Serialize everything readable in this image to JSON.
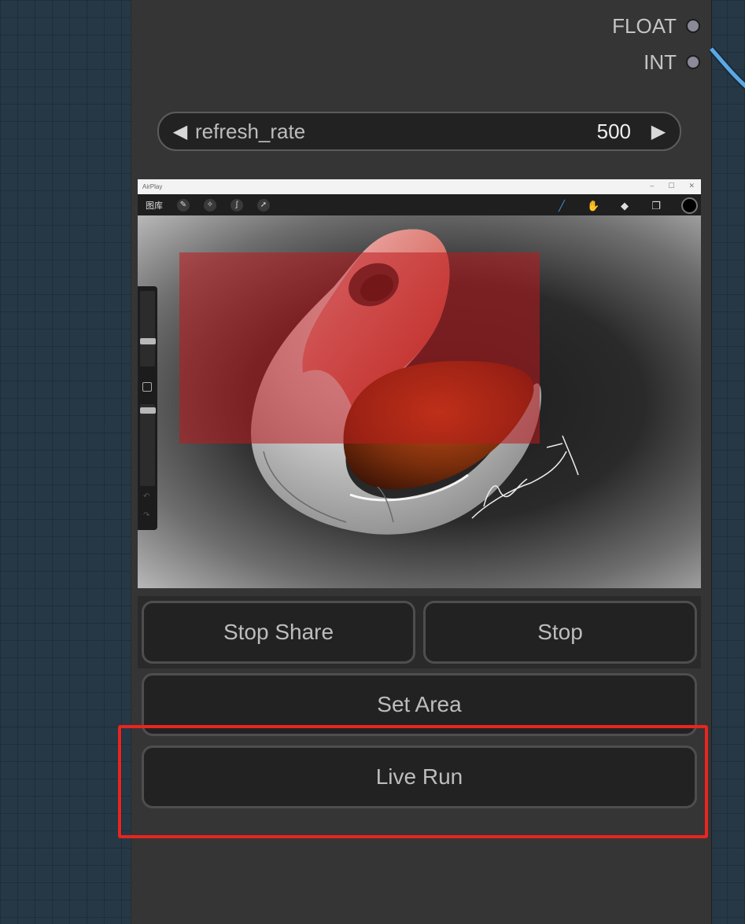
{
  "outputs": [
    {
      "label": "FLOAT"
    },
    {
      "label": "INT"
    }
  ],
  "widget": {
    "label": "refresh_rate",
    "value": "500",
    "left_arrow": "◀",
    "right_arrow": "▶"
  },
  "preview": {
    "window_title": "AirPlay",
    "window_controls": [
      "–",
      "☐",
      "✕"
    ],
    "toolbar_label": "图库",
    "toolbar_left_icons": [
      "wrench-icon",
      "magic-wand-icon",
      "selection-s-icon",
      "arrow-cursor-icon"
    ],
    "toolbar_right_icons": [
      "brush-icon",
      "smudge-icon",
      "eraser-icon",
      "layers-icon",
      "color-swatch-icon"
    ],
    "selection_color": "#be191e"
  },
  "buttons": {
    "stop_share": "Stop Share",
    "stop": "Stop",
    "set_area": "Set Area",
    "live_run": "Live Run"
  },
  "colors": {
    "graph_background": "#263846",
    "node_background": "#353535",
    "button_background": "#222222",
    "highlight_border": "#e8251f",
    "wire": "#5aa9e6"
  }
}
